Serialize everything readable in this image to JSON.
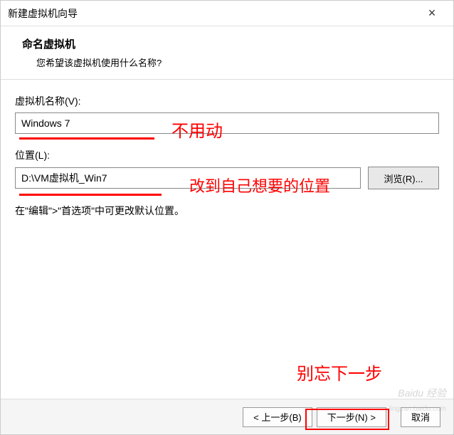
{
  "window": {
    "title": "新建虚拟机向导"
  },
  "header": {
    "title": "命名虚拟机",
    "subtitle": "您希望该虚拟机使用什么名称?"
  },
  "fields": {
    "name_label": "虚拟机名称(V):",
    "name_value": "Windows 7",
    "location_label": "位置(L):",
    "location_value": "D:\\VM虚拟机_Win7",
    "browse_label": "浏览(R)..."
  },
  "help_text": "在\"编辑\">\"首选项\"中可更改默认位置。",
  "annotations": {
    "dont_touch": "不用动",
    "change_location": "改到自己想要的位置",
    "dont_forget": "别忘下一步"
  },
  "buttons": {
    "back": "< 上一步(B)",
    "next": "下一步(N) >",
    "cancel": "取消"
  },
  "watermark": {
    "main": "Baidu 经验",
    "sub": "jingyan.baidu.com"
  }
}
